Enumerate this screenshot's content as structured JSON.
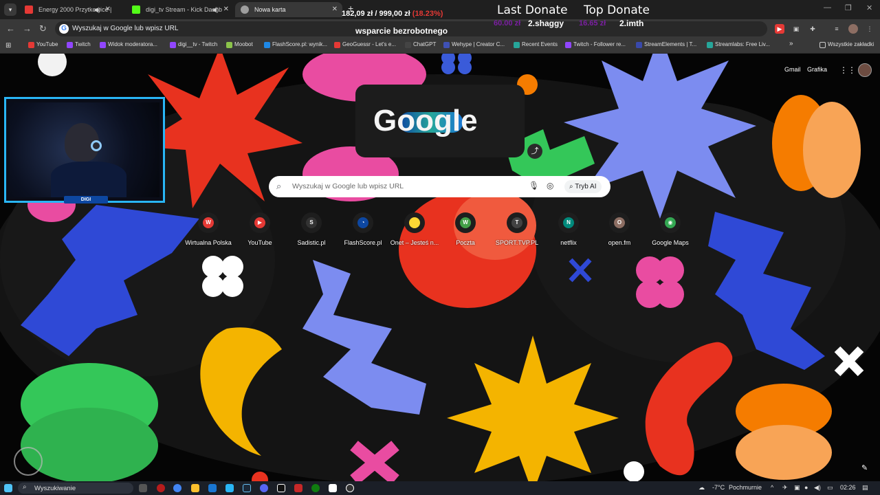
{
  "tabs": [
    {
      "title": "Energy 2000 Przytkowice | ",
      "favicon_color": "#e53935"
    },
    {
      "title": "digi_tv Stream - Kick Dashb",
      "favicon_color": "#53fc18"
    },
    {
      "title": "Nowa karta",
      "favicon_color": "#9e9e9e"
    }
  ],
  "toolbar": {
    "omnibox_text": "Wyszukaj w Google lub wpisz URL"
  },
  "bookmarks": [
    {
      "label": "YouTube",
      "color": "#e53935"
    },
    {
      "label": "Twitch",
      "color": "#9146ff"
    },
    {
      "label": "Widok moderatora...",
      "color": "#9146ff"
    },
    {
      "label": "digi__tv - Twitch",
      "color": "#9146ff"
    },
    {
      "label": "Moobot",
      "color": "#8bc34a"
    },
    {
      "label": "FlashScore.pl: wynik...",
      "color": "#1e88e5"
    },
    {
      "label": "GeoGuessr - Let's e...",
      "color": "#e53935"
    },
    {
      "label": "ChatGPT",
      "color": "#444"
    },
    {
      "label": "Wehype | Creator C...",
      "color": "#3f51b5"
    },
    {
      "label": "Recent Events",
      "color": "#26a69a"
    },
    {
      "label": "Twitch - Follower re...",
      "color": "#9146ff"
    },
    {
      "label": "StreamElements | T...",
      "color": "#3949ab"
    },
    {
      "label": "Streamlabs: Free Liv...",
      "color": "#26a69a"
    }
  ],
  "bookmarks_more": "»",
  "all_bookmarks": "Wszystkie zakładki",
  "overlay": {
    "goal_current": "182,09 zł",
    "goal_separator": "/",
    "goal_target": "999,00 zł",
    "goal_percent": "(18.23%)",
    "goal_label": "wsparcie bezrobotnego",
    "last_donate_title": "Last Donate",
    "last_donate_amount": "60.00 zł",
    "last_donate_name": "2.shaggy",
    "top_donate_title": "Top Donate",
    "top_donate_amount": "16.65 zł",
    "top_donate_name": "2.imth"
  },
  "ntp": {
    "gmail": "Gmail",
    "images": "Grafika",
    "doodle_text": "Google",
    "search_placeholder": "Wyszukaj w Google lub wpisz URL",
    "ai_mode": "Tryb AI",
    "shortcuts": [
      {
        "label": "Wirtualna Polska",
        "icon_text": "W",
        "color": "#e53935"
      },
      {
        "label": "YouTube",
        "icon_text": "▶",
        "color": "#e53935"
      },
      {
        "label": "Sadistic.pl",
        "icon_text": "S",
        "color": "#333"
      },
      {
        "label": "FlashScore.pl",
        "icon_text": "◔",
        "color": "#0d47a1"
      },
      {
        "label": "Onet – Jesteś n...",
        "icon_text": "",
        "color": "#fdd835"
      },
      {
        "label": "Poczta",
        "icon_text": "W",
        "color": "#43a047"
      },
      {
        "label": "SPORT.TVP.PL",
        "icon_text": "T",
        "color": "#424242"
      },
      {
        "label": "netflix",
        "icon_text": "N",
        "color": "#00897b"
      },
      {
        "label": "open.fm",
        "icon_text": "O",
        "color": "#8d6e63"
      },
      {
        "label": "Google Maps",
        "icon_text": "◉",
        "color": "#34a853"
      }
    ]
  },
  "webcam": {
    "tag": "DIGI"
  },
  "taskbar": {
    "search_label": "Wyszukiwanie",
    "weather": "-7°C",
    "weather_desc": "Pochmurnie",
    "time": "02:26"
  },
  "colors": {
    "accent": "#29b6f6",
    "bg_red": "#e8321f",
    "bg_blue": "#3a5bd9",
    "bg_green": "#34c759",
    "bg_orange": "#f57c00",
    "bg_pink": "#e94ca1",
    "bg_yellow": "#f4b400"
  }
}
